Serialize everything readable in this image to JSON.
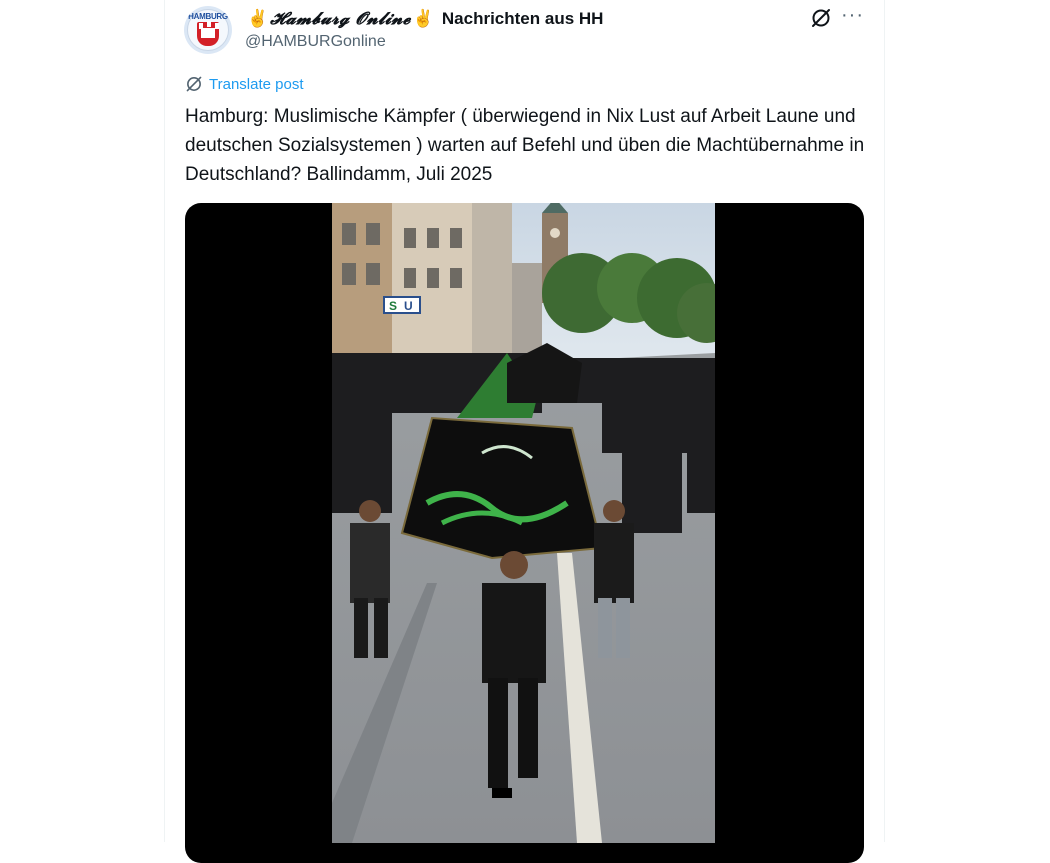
{
  "author": {
    "display_name_stylized": "𝓗𝓪𝓶𝓫𝓾𝓻𝓰 𝓞𝓷𝓵𝓲𝓷𝓮",
    "display_name_suffix": "Nachrichten aus HH",
    "emoji": "✌",
    "handle": "@HAMBURGonline",
    "avatar_label": "HAMBURG"
  },
  "actions": {
    "grok_icon": "grok-icon",
    "more_icon": "more-icon",
    "more_glyph": "···"
  },
  "translate": {
    "label": "Translate post",
    "icon": "translate-icon"
  },
  "post": {
    "text": "Hamburg: Muslimische Kämpfer ( überwiegend in Nix Lust auf Arbeit Laune und deutschen Sozialsystemen ) warten auf Befehl und üben die Machtübernahme in Deutschland? Ballindamm, Juli 2025"
  },
  "colors": {
    "accent": "#1d9bf0",
    "text": "#0f1419",
    "muted": "#536471",
    "banner_green": "#3fb34a"
  }
}
